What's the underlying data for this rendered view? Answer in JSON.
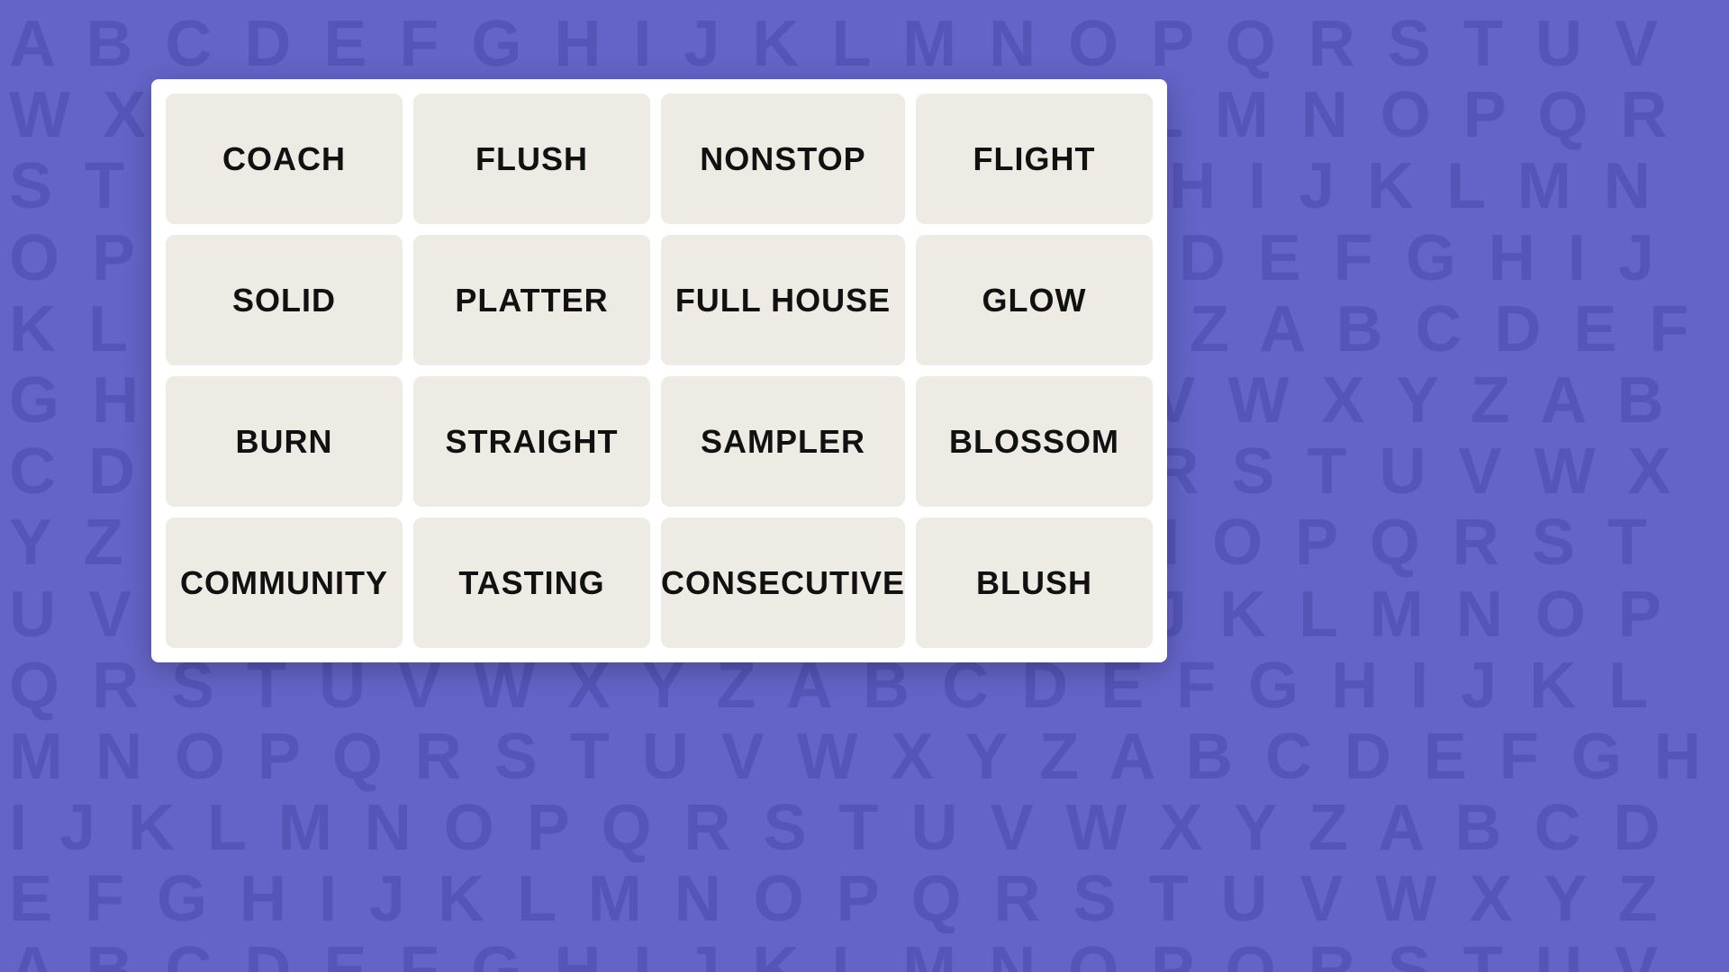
{
  "background": {
    "color": "#6464c8",
    "text_color": "#5555b8",
    "alphabet_text": "A B C D E F G H I J K L M N O P Q R S T U V W X Y Z A B C D E F G H I J K L M N O P Q R S T U V W X Y Z A B C D E F G H I J K L M N O P Q R S T U V W X Y Z A B C D E F G H I J K L M N O P Q R S T U V W X Y Z A B C D E F G H I J K L M N O P Q R S T U V W X Y Z A B C D E F G H I J K L M N O P Q R S T U V W X Y Z A B C D E F G H I J K L M N O P Q R S T U V W X Y Z A B C D E F G H I J K L M N O P Q R S T U V W X Y Z A B C D E F G H I J K L M N O P Q R S T U V W X Y Z A B C D E F G H I J K L M N O P Q R S T U V W X Y Z A B C D E F G H I J K L M N O P Q R S T U V W X Y Z A B C D E F G H I J K L M N O P Q R S T U V W X Y Z A B C D E F G H I J K L M N O P Q R S T U V W X Y Z"
  },
  "panel": {
    "background": "#ffffff"
  },
  "cards": [
    {
      "label": "COACH"
    },
    {
      "label": "FLUSH"
    },
    {
      "label": "NONSTOP"
    },
    {
      "label": "FLIGHT"
    },
    {
      "label": "SOLID"
    },
    {
      "label": "PLATTER"
    },
    {
      "label": "FULL HOUSE"
    },
    {
      "label": "GLOW"
    },
    {
      "label": "BURN"
    },
    {
      "label": "STRAIGHT"
    },
    {
      "label": "SAMPLER"
    },
    {
      "label": "BLOSSOM"
    },
    {
      "label": "COMMUNITY"
    },
    {
      "label": "TASTING"
    },
    {
      "label": "CONSECUTIVE"
    },
    {
      "label": "BLUSH"
    }
  ]
}
